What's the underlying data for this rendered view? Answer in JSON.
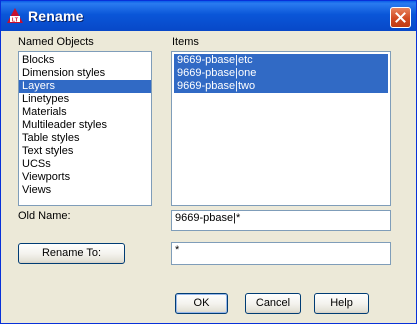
{
  "dialog": {
    "title": "Rename"
  },
  "named_objects": {
    "label": "Named Objects",
    "items": [
      {
        "label": "Blocks",
        "selected": false
      },
      {
        "label": "Dimension styles",
        "selected": false
      },
      {
        "label": "Layers",
        "selected": true
      },
      {
        "label": "Linetypes",
        "selected": false
      },
      {
        "label": "Materials",
        "selected": false
      },
      {
        "label": "Multileader styles",
        "selected": false
      },
      {
        "label": "Table styles",
        "selected": false
      },
      {
        "label": "Text styles",
        "selected": false
      },
      {
        "label": "UCSs",
        "selected": false
      },
      {
        "label": "Viewports",
        "selected": false
      },
      {
        "label": "Views",
        "selected": false
      }
    ]
  },
  "items_list": {
    "label": "Items",
    "items": [
      {
        "label": "9669-pbase|etc",
        "selected": true
      },
      {
        "label": "9669-pbase|one",
        "selected": true
      },
      {
        "label": "9669-pbase|two",
        "selected": true
      }
    ]
  },
  "old_name": {
    "label": "Old Name:",
    "value": "9669-pbase|*"
  },
  "rename_to": {
    "button_label": "Rename To:",
    "value": "*"
  },
  "buttons": {
    "ok": "OK",
    "cancel": "Cancel",
    "help": "Help"
  },
  "colors": {
    "selection": "#316ac5",
    "titlebar": "#0a56d8",
    "dialog_bg": "#ece9d8"
  }
}
